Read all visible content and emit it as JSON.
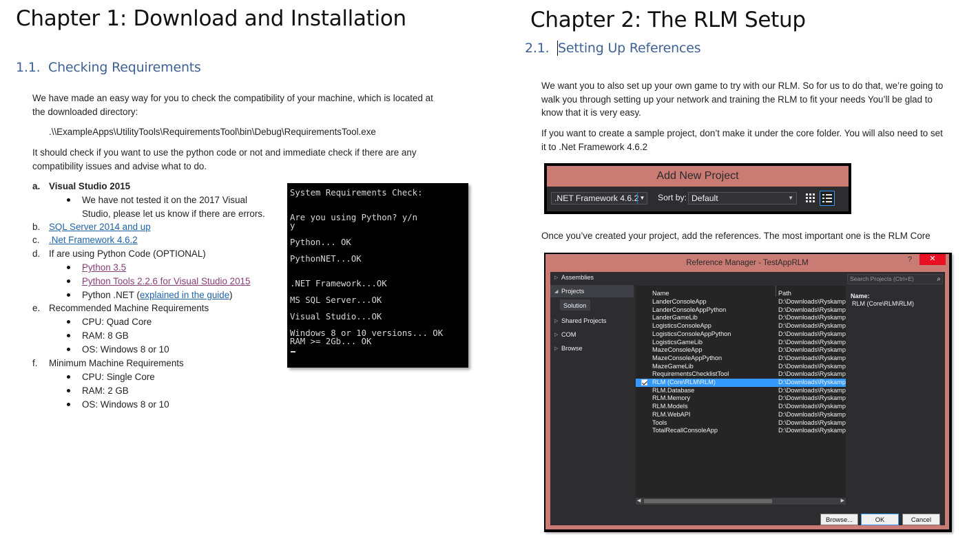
{
  "left": {
    "chapter_title": "Chapter 1: Download and Installation",
    "section_num": "1.1.",
    "section_title": "Checking Requirements",
    "intro_line1": "We have made an easy way for you to check the compatibility of your machine, which is located at",
    "intro_line2": "the downloaded directory:",
    "path": ".\\\\ExampleApps\\UtilityTools\\RequirementsTool\\bin\\Debug\\RequirementsTool.exe",
    "check_line1": "It should check if you want to use the python code or not and immediate check if there are any",
    "check_line2": "compatibility issues and advise what to do.",
    "list": {
      "a_marker": "a.",
      "a_text": "Visual Studio 2015",
      "a_sub1_line1": "We have not tested it on the 2017 Visual",
      "a_sub1_line2": "Studio, please let us know if there are errors.",
      "b_marker": "b.",
      "b_text": "SQL Server 2014 and up",
      "c_marker": "c.",
      "c_text": ".Net Framework 4.6.2",
      "d_marker": "d.",
      "d_text": "If are using Python Code (OPTIONAL)",
      "d_sub1": "Python 3.5",
      "d_sub2": "Python Tools 2.2.6 for Visual Studio 2015",
      "d_sub3_pre": "Python .NET (",
      "d_sub3_link": "explained in the guide",
      "d_sub3_post": ")",
      "e_marker": "e.",
      "e_text": "Recommended Machine Requirements",
      "e_sub1": "CPU: Quad Core",
      "e_sub2": "RAM: 8 GB",
      "e_sub3": "OS: Windows 8 or 10",
      "f_marker": "f.",
      "f_text": "Minimum Machine Requirements",
      "f_sub1": "CPU: Single Core",
      "f_sub2": "RAM: 2 GB",
      "f_sub3": "OS: Windows 8 or 10"
    },
    "console": {
      "l1": "System Requirements Check:",
      "l2": "Are you using Python? y/n",
      "l3": "y",
      "l4": "Python... OK",
      "l5": "PythonNET...OK",
      "l6": ".NET Framework...OK",
      "l7": "MS SQL Server...OK",
      "l8": "Visual Studio...OK",
      "l9": "Windows 8 or 10 versions... OK",
      "l10": "RAM >= 2Gb... OK"
    }
  },
  "right": {
    "chapter_title": "Chapter 2: The RLM Setup",
    "section_num": "2.1.",
    "section_title": "Setting Up References",
    "p1_line1": "We want you to also set up your own game to try with our RLM. So for us to do that, we’re going to",
    "p1_line2": "walk you through setting up your network and training the RLM to fit your needs You’ll be glad to",
    "p1_line3": "know that it is very easy.",
    "p2_line1": "If you want to create a sample project, don’t make it under the core folder. You will also need to set",
    "p2_line2": "it to .Net Framework 4.6.2",
    "p3": "Once you’ve created your project, add the references. The most important one is the RLM Core",
    "add_new_project": {
      "title": "Add New Project",
      "framework": ".NET Framework 4.6.2",
      "sort_label": "Sort by:",
      "sort_value": "Default"
    },
    "ref_manager": {
      "title": "Reference Manager - TestAppRLM",
      "help": "?",
      "close": "✕",
      "tree": {
        "assemblies": "Assemblies",
        "projects": "Projects",
        "solution": "Solution",
        "shared": "Shared Projects",
        "com": "COM",
        "browse": "Browse"
      },
      "col_name": "Name",
      "col_path": "Path",
      "search_placeholder": "Search Projects (Ctrl+E)",
      "rows": [
        {
          "name": "LanderConsoleApp",
          "path": "D:\\Downloads\\RyskampL"
        },
        {
          "name": "LanderConsoleAppPython",
          "path": "D:\\Downloads\\RyskampL"
        },
        {
          "name": "LanderGameLib",
          "path": "D:\\Downloads\\RyskampL"
        },
        {
          "name": "LogisticsConsoleApp",
          "path": "D:\\Downloads\\RyskampL"
        },
        {
          "name": "LogisticsConsoleAppPython",
          "path": "D:\\Downloads\\RyskampL"
        },
        {
          "name": "LogisticsGameLib",
          "path": "D:\\Downloads\\RyskampL"
        },
        {
          "name": "MazeConsoleApp",
          "path": "D:\\Downloads\\RyskampL"
        },
        {
          "name": "MazeConsoleAppPython",
          "path": "D:\\Downloads\\RyskampL"
        },
        {
          "name": "MazeGameLib",
          "path": "D:\\Downloads\\RyskampL"
        },
        {
          "name": "RequirementsChecklistTool",
          "path": "D:\\Downloads\\RyskampL"
        },
        {
          "name": "RLM (Core\\RLM\\RLM)",
          "path": "D:\\Downloads\\RyskampL"
        },
        {
          "name": "RLM.Database",
          "path": "D:\\Downloads\\RyskampL"
        },
        {
          "name": "RLM.Memory",
          "path": "D:\\Downloads\\RyskampL"
        },
        {
          "name": "RLM.Models",
          "path": "D:\\Downloads\\RyskampL"
        },
        {
          "name": "RLM.WebAPI",
          "path": "D:\\Downloads\\RyskampL"
        },
        {
          "name": "Tools",
          "path": "D:\\Downloads\\RyskampL"
        },
        {
          "name": "TotalRecallConsoleApp",
          "path": "D:\\Downloads\\RyskampL"
        }
      ],
      "selected_index": 10,
      "detail_label": "Name:",
      "detail_value": "RLM (Core\\RLM\\RLM)",
      "btn_browse": "Browse...",
      "btn_ok": "OK",
      "btn_cancel": "Cancel"
    }
  }
}
